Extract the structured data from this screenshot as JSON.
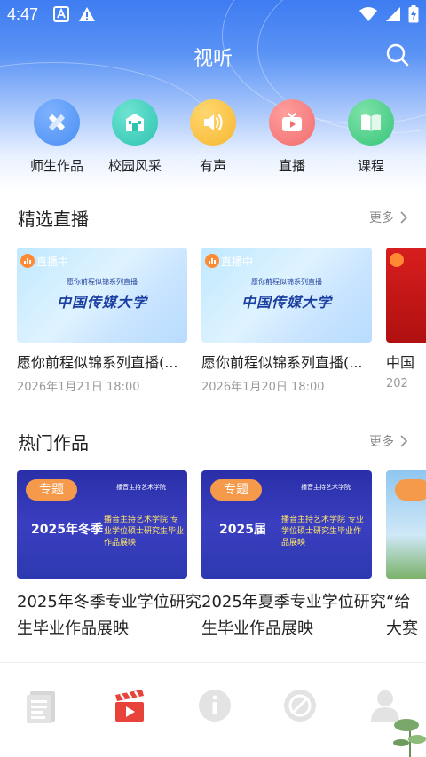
{
  "status_bar": {
    "time": "4:47"
  },
  "header": {
    "title": "视听",
    "search_icon": "search-icon"
  },
  "quick_nav": [
    {
      "label": "师生作品",
      "icon": "pencil-ruler-icon",
      "color": "#4a8ff3"
    },
    {
      "label": "校园风采",
      "icon": "campus-building-icon",
      "color": "#2ec4b0"
    },
    {
      "label": "有声",
      "icon": "speaker-icon",
      "color": "#f6b72f"
    },
    {
      "label": "直播",
      "icon": "tv-play-icon",
      "color": "#f26d6d"
    },
    {
      "label": "课程",
      "icon": "book-icon",
      "color": "#36c67a"
    }
  ],
  "live_section": {
    "title": "精选直播",
    "more": "更多",
    "cards": [
      {
        "badge": "直播中",
        "thumb_sub": "愿你前程似锦系列直播",
        "thumb_main": "中国传媒大学",
        "title": "愿你前程似锦系列直播(...",
        "date": "2026年1月21日 18:00"
      },
      {
        "badge": "直播中",
        "thumb_sub": "愿你前程似锦系列直播",
        "thumb_main": "中国传媒大学",
        "title": "愿你前程似锦系列直播(...",
        "date": "2026年1月20日 18:00"
      }
    ],
    "partial": {
      "title": "中国",
      "date": "202"
    }
  },
  "hot_section": {
    "title": "热门作品",
    "more": "更多",
    "cards": [
      {
        "badge": "专题",
        "brand": "播音主持艺术学院",
        "year_line": "2025年冬季",
        "subtitle": "播音主持艺术学院 专业学位硕士研究生毕业作品展映",
        "title": "2025年冬季专业学位研究生毕业作品展映"
      },
      {
        "badge": "专题",
        "brand": "播音主持艺术学院",
        "year_line": "2025届",
        "subtitle": "播音主持艺术学院 专业学位硕士研究生毕业作品展映",
        "title": "2025年夏季专业学位研究生毕业作品展映"
      }
    ],
    "partial": {
      "title": "“给 大赛"
    }
  },
  "tab_bar": [
    {
      "name": "news",
      "icon": "newspaper-icon",
      "active": false
    },
    {
      "name": "video",
      "icon": "clapperboard-icon",
      "active": true
    },
    {
      "name": "info",
      "icon": "info-icon",
      "active": false
    },
    {
      "name": "service",
      "icon": "compass-icon",
      "active": false
    },
    {
      "name": "profile",
      "icon": "user-icon",
      "active": false
    }
  ],
  "colors": {
    "accent": "#3e7cf2",
    "active_tab": "#e8433a",
    "inactive_tab": "#cfcfcf"
  }
}
